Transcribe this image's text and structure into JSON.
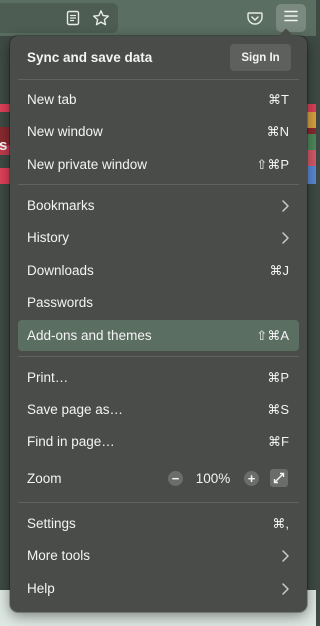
{
  "toolbar": {
    "icons": [
      "reader-view-icon",
      "bookmark-star-icon",
      "pocket-icon",
      "hamburger-menu-icon"
    ]
  },
  "page": {
    "edge_text": "s"
  },
  "menu": {
    "sync_title": "Sync and save data",
    "sign_in_label": "Sign In",
    "items": [
      {
        "label": "New tab",
        "shortcut": "⌘T"
      },
      {
        "label": "New window",
        "shortcut": "⌘N"
      },
      {
        "label": "New private window",
        "shortcut": "⇧⌘P"
      },
      {
        "label": "Bookmarks",
        "submenu": true
      },
      {
        "label": "History",
        "submenu": true
      },
      {
        "label": "Downloads",
        "shortcut": "⌘J"
      },
      {
        "label": "Passwords"
      },
      {
        "label": "Add-ons and themes",
        "shortcut": "⇧⌘A",
        "highlighted": true
      },
      {
        "label": "Print…",
        "shortcut": "⌘P"
      },
      {
        "label": "Save page as…",
        "shortcut": "⌘S"
      },
      {
        "label": "Find in page…",
        "shortcut": "⌘F"
      },
      {
        "label": "Settings",
        "shortcut": "⌘,"
      },
      {
        "label": "More tools",
        "submenu": true
      },
      {
        "label": "Help",
        "submenu": true
      }
    ],
    "zoom": {
      "label": "Zoom",
      "minus": "−",
      "level": "100%",
      "plus": "+"
    }
  },
  "colors": {
    "panel_bg": "#494c49",
    "highlight": "#5b6e62",
    "toolbar": "#5b6e62",
    "page_stripes": [
      "#e0405a",
      "#8a2a30",
      "#e0405a",
      "#d9a441",
      "#4e8a5c",
      "#d85a6a",
      "#5a8ad8"
    ]
  }
}
